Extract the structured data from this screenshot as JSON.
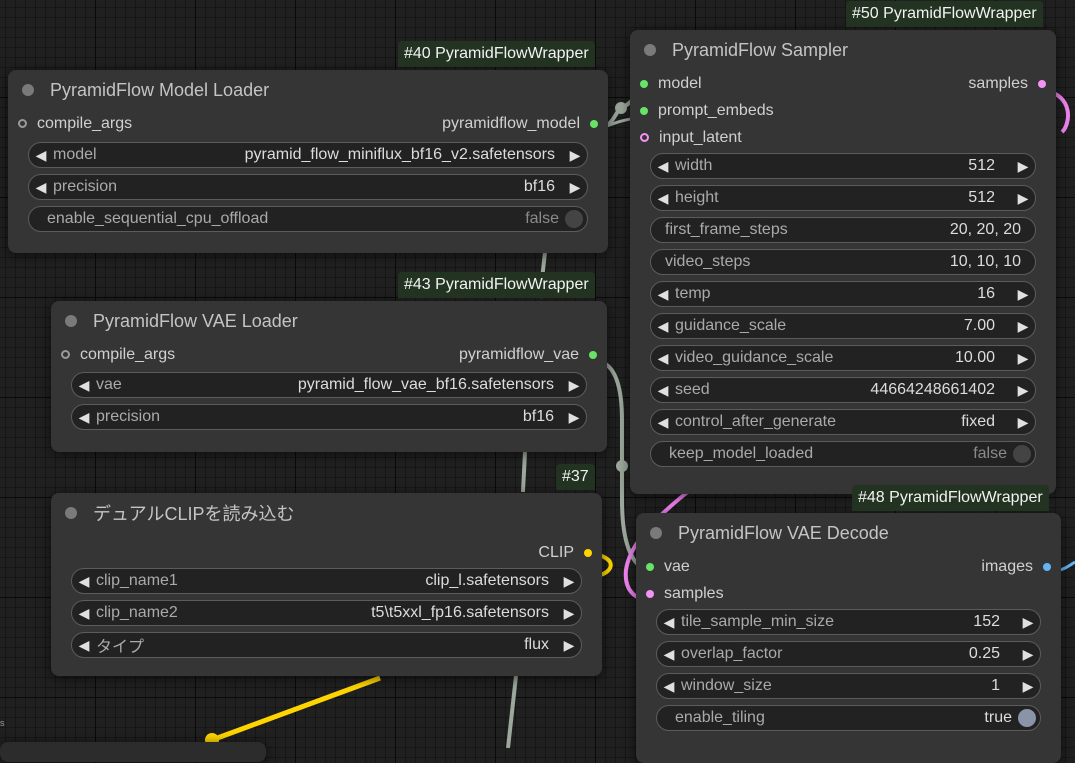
{
  "colors": {
    "model_slot": "#67e467",
    "embeds_slot": "#67e467",
    "latent_slot": "#f393f3",
    "clip_slot": "#ffd500",
    "image_slot": "#64b5f6",
    "link_grey": "#9ca89c",
    "link_pink": "#ee82ee",
    "link_yellow": "#ffd500",
    "badge_bg": "#233321"
  },
  "misc": {
    "hint": "s"
  },
  "model_loader": {
    "badge": "#40 PyramidFlowWrapper",
    "title": "PyramidFlow Model Loader",
    "input": "compile_args",
    "output": "pyramidflow_model",
    "widgets": {
      "model": {
        "label": "model",
        "value": "pyramid_flow_miniflux_bf16_v2.safetensors"
      },
      "precision": {
        "label": "precision",
        "value": "bf16"
      },
      "offload": {
        "label": "enable_sequential_cpu_offload",
        "value": "false"
      }
    }
  },
  "vae_loader": {
    "badge": "#43 PyramidFlowWrapper",
    "title": "PyramidFlow VAE Loader",
    "input": "compile_args",
    "output": "pyramidflow_vae",
    "widgets": {
      "vae": {
        "label": "vae",
        "value": "pyramid_flow_vae_bf16.safetensors"
      },
      "precision": {
        "label": "precision",
        "value": "bf16"
      }
    }
  },
  "clip_loader": {
    "badge": "#37",
    "title": "デュアルCLIPを読み込む",
    "output": "CLIP",
    "widgets": {
      "clip1": {
        "label": "clip_name1",
        "value": "clip_l.safetensors"
      },
      "clip2": {
        "label": "clip_name2",
        "value": "t5\\t5xxl_fp16.safetensors"
      },
      "type": {
        "label": "タイプ",
        "value": "flux"
      }
    }
  },
  "sampler": {
    "badge": "#50 PyramidFlowWrapper",
    "title": "PyramidFlow Sampler",
    "inputs": {
      "model": "model",
      "prompt_embeds": "prompt_embeds",
      "input_latent": "input_latent"
    },
    "output": "samples",
    "widgets": {
      "width": {
        "label": "width",
        "value": "512"
      },
      "height": {
        "label": "height",
        "value": "512"
      },
      "first_frame_steps": {
        "label": "first_frame_steps",
        "value": "20, 20, 20"
      },
      "video_steps": {
        "label": "video_steps",
        "value": "10, 10, 10"
      },
      "temp": {
        "label": "temp",
        "value": "16"
      },
      "guidance_scale": {
        "label": "guidance_scale",
        "value": "7.00"
      },
      "video_guidance_scale": {
        "label": "video_guidance_scale",
        "value": "10.00"
      },
      "seed": {
        "label": "seed",
        "value": "44664248661402"
      },
      "control_after_generate": {
        "label": "control_after_generate",
        "value": "fixed"
      },
      "keep_model_loaded": {
        "label": "keep_model_loaded",
        "value": "false"
      }
    }
  },
  "vae_decode": {
    "badge": "#48 PyramidFlowWrapper",
    "title": "PyramidFlow VAE Decode",
    "inputs": {
      "vae": "vae",
      "samples": "samples"
    },
    "output": "images",
    "widgets": {
      "tile_sample_min_size": {
        "label": "tile_sample_min_size",
        "value": "152"
      },
      "overlap_factor": {
        "label": "overlap_factor",
        "value": "0.25"
      },
      "window_size": {
        "label": "window_size",
        "value": "1"
      },
      "enable_tiling": {
        "label": "enable_tiling",
        "value": "true"
      }
    }
  }
}
